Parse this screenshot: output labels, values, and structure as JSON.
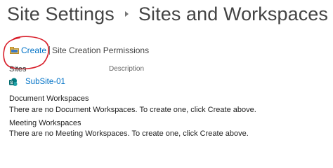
{
  "header": {
    "breadcrumb_root": "Site Settings",
    "page_title": "Sites and Workspaces"
  },
  "toolbar": {
    "create_label": "Create",
    "separator": "|",
    "permissions_label": "Site Creation Permissions"
  },
  "table": {
    "columns": [
      "Sites",
      "Description"
    ],
    "rows": [
      {
        "name": "SubSite-01",
        "description": ""
      }
    ]
  },
  "sections": [
    {
      "heading": "Document Workspaces",
      "message": "There are no Document Workspaces. To create one, click Create above."
    },
    {
      "heading": "Meeting Workspaces",
      "message": "There are no Meeting Workspaces. To create one, click Create above."
    }
  ],
  "colors": {
    "link": "#0072c6",
    "annotation": "#d81e2a",
    "sharepoint": "#03787c"
  },
  "icons": {
    "create": "create-folder-icon",
    "site": "sharepoint-site-icon",
    "breadcrumb": "breadcrumb-arrow-icon"
  }
}
